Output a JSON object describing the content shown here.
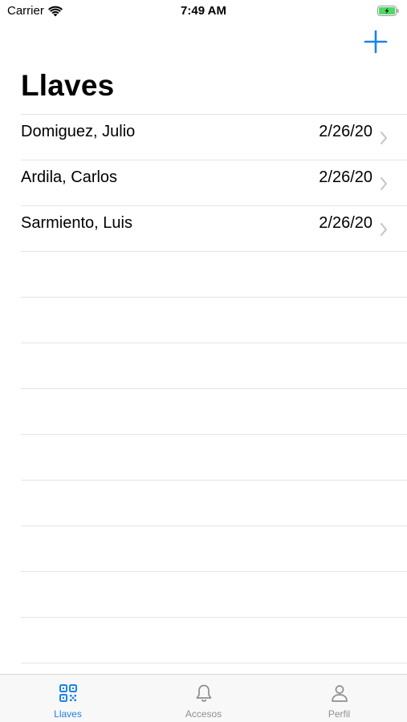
{
  "status_bar": {
    "carrier": "Carrier",
    "time": "7:49 AM"
  },
  "nav": {
    "title": "Llaves",
    "add_icon": "plus-icon"
  },
  "list": {
    "items": [
      {
        "name": "Domiguez, Julio",
        "date": "2/26/20"
      },
      {
        "name": "Ardila, Carlos",
        "date": "2/26/20"
      },
      {
        "name": "Sarmiento, Luis",
        "date": "2/26/20"
      }
    ]
  },
  "tab_bar": {
    "tabs": [
      {
        "label": "Llaves",
        "icon": "qr-code-icon",
        "active": true
      },
      {
        "label": "Accesos",
        "icon": "bell-icon",
        "active": false
      },
      {
        "label": "Perfil",
        "icon": "person-icon",
        "active": false
      }
    ]
  },
  "colors": {
    "accent": "#1a82e8",
    "inactive": "#8e8e93",
    "battery": "#4cd964"
  }
}
